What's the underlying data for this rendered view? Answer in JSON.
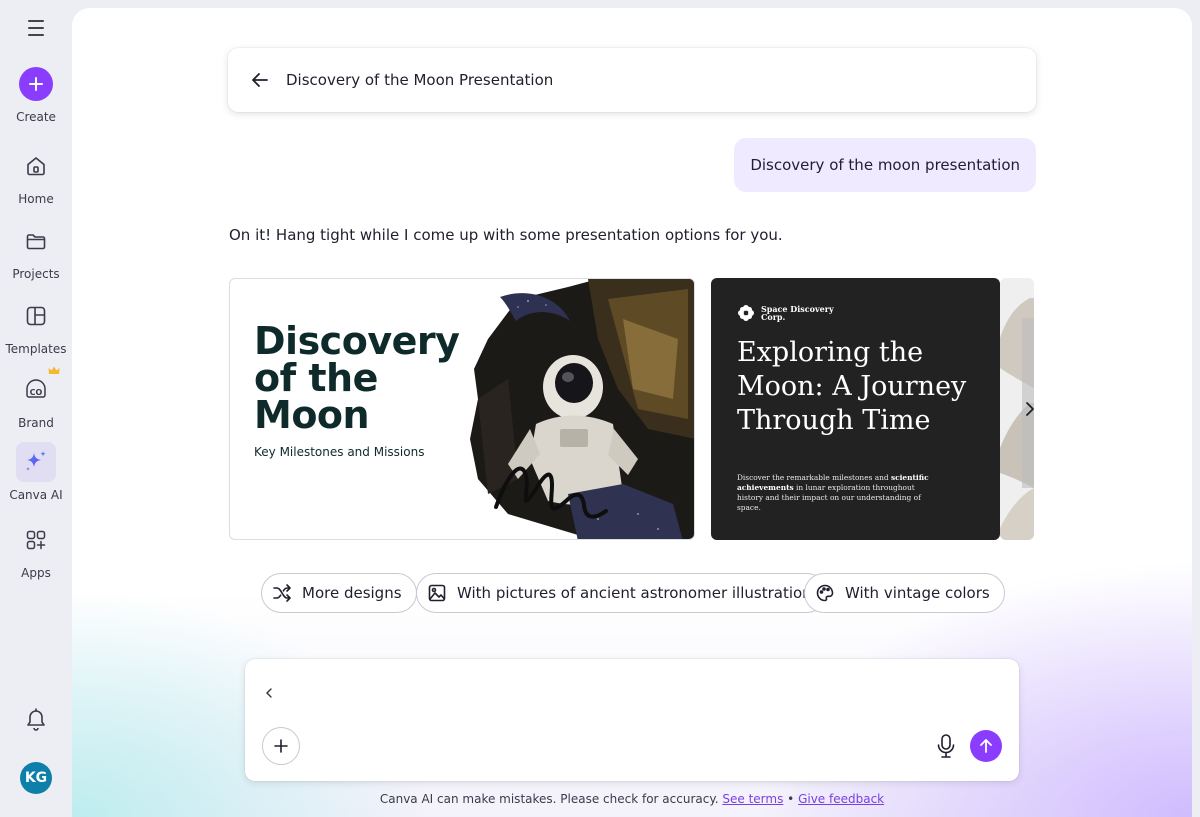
{
  "sidebar": {
    "items": [
      {
        "label": "Create"
      },
      {
        "label": "Home"
      },
      {
        "label": "Projects"
      },
      {
        "label": "Templates"
      },
      {
        "label": "Brand",
        "badge_icon": "crown-icon"
      },
      {
        "label": "Canva AI",
        "active": true
      },
      {
        "label": "Apps"
      }
    ],
    "avatar_initials": "KG"
  },
  "header": {
    "title": "Discovery of the Moon Presentation"
  },
  "chat": {
    "user_message": "Discovery of the moon presentation",
    "assistant_message": "On it! Hang tight while I come up with some presentation options for you."
  },
  "designs": [
    {
      "title_lines": [
        "Discovery",
        "of the",
        "Moon"
      ],
      "subtitle": "Key Milestones and Missions"
    },
    {
      "logo_line1": "Space Discovery",
      "logo_line2": "Corp.",
      "title": "Exploring the Moon: A Journey Through Time",
      "body_pre": "Discover the remarkable milestones and ",
      "body_bold": "scientific achievements",
      "body_post": " in lunar exploration throughout history and their impact on our understanding of space."
    }
  ],
  "suggestions": [
    {
      "label": "More designs",
      "icon": "shuffle-icon"
    },
    {
      "label": "With pictures of ancient astronomer illustration",
      "icon": "image-icon"
    },
    {
      "label": "With vintage colors",
      "icon": "palette-icon"
    }
  ],
  "composer": {
    "value": "",
    "placeholder": ""
  },
  "footer": {
    "disclaimer": "Canva AI can make mistakes. Please check for accuracy.",
    "see_terms": "See terms",
    "separator": "•",
    "give_feedback": "Give feedback"
  },
  "colors": {
    "accent": "#8b3dff",
    "bubble": "#efeaff",
    "dark_card": "#222222"
  }
}
